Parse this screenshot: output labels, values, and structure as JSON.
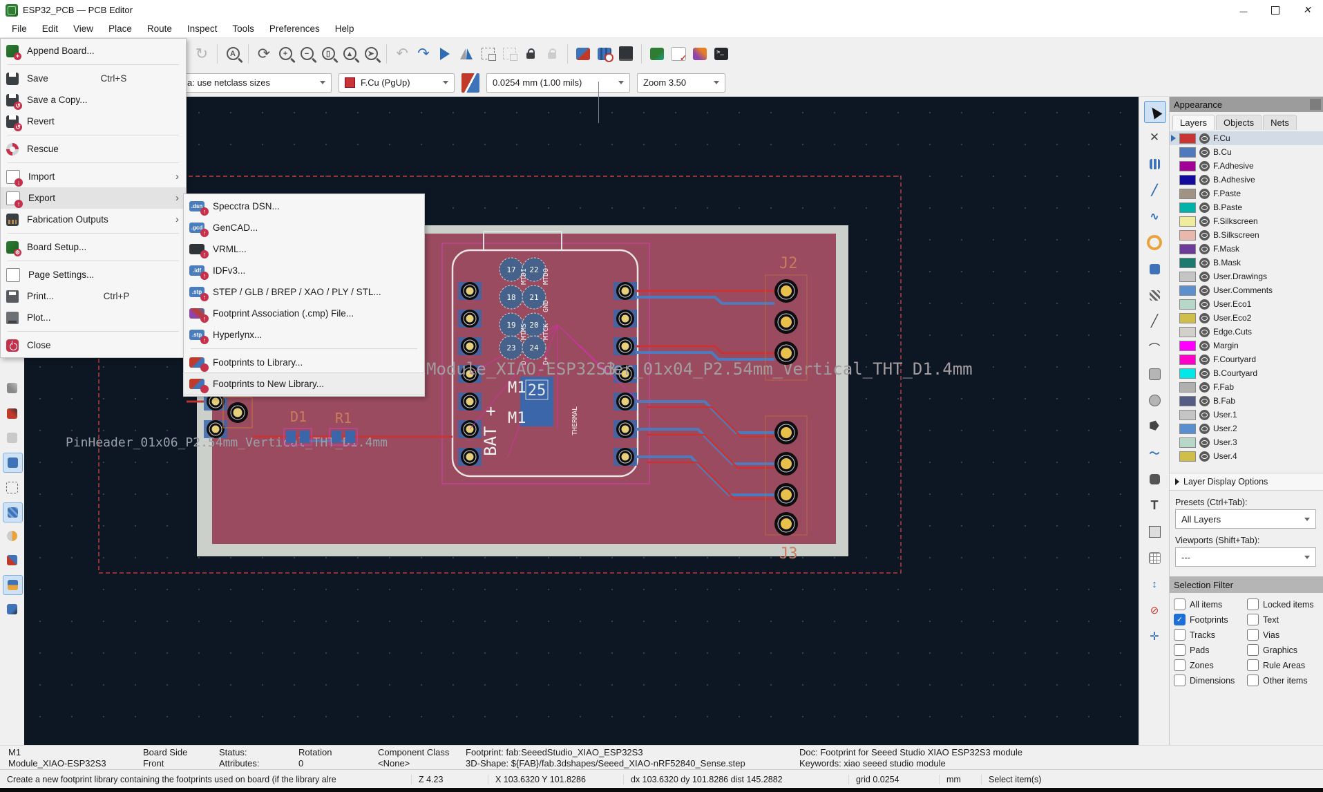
{
  "window": {
    "title": "ESP32_PCB — PCB Editor"
  },
  "menubar": {
    "items": [
      {
        "label": "File"
      },
      {
        "label": "Edit"
      },
      {
        "label": "View"
      },
      {
        "label": "Place"
      },
      {
        "label": "Route"
      },
      {
        "label": "Inspect"
      },
      {
        "label": "Tools"
      },
      {
        "label": "Preferences"
      },
      {
        "label": "Help"
      }
    ]
  },
  "file_menu": {
    "items": [
      {
        "label": "Append Board...",
        "icon": "append"
      },
      {
        "sep": true
      },
      {
        "label": "Save",
        "shortcut": "Ctrl+S",
        "icon": "save"
      },
      {
        "label": "Save a Copy...",
        "icon": "save-copy"
      },
      {
        "label": "Revert",
        "icon": "revert"
      },
      {
        "sep": true
      },
      {
        "label": "Rescue",
        "icon": "rescue"
      },
      {
        "sep": true
      },
      {
        "label": "Import",
        "arrow": "›",
        "icon": "import"
      },
      {
        "label": "Export",
        "arrow": "›",
        "icon": "export",
        "highlighted": true
      },
      {
        "label": "Fabrication Outputs",
        "arrow": "›",
        "icon": "fab"
      },
      {
        "sep": true
      },
      {
        "label": "Board Setup...",
        "icon": "board-setup"
      },
      {
        "sep": true
      },
      {
        "label": "Page Settings...",
        "icon": "page"
      },
      {
        "label": "Print...",
        "shortcut": "Ctrl+P",
        "icon": "print"
      },
      {
        "label": "Plot...",
        "icon": "plot"
      },
      {
        "sep": true
      },
      {
        "label": "Close",
        "icon": "close"
      }
    ]
  },
  "export_submenu": {
    "items": [
      {
        "label": "Specctra DSN...",
        "badge": ".dsn",
        "icon": "dsn"
      },
      {
        "label": "GenCAD...",
        "badge": ".gcd",
        "icon": "gcd"
      },
      {
        "label": "VRML...",
        "badge": "",
        "icon": "vrml"
      },
      {
        "label": "IDFv3...",
        "badge": ".idf",
        "icon": "idf"
      },
      {
        "label": "STEP / GLB / BREP / XAO / PLY / STL...",
        "badge": ".stp",
        "icon": "stp"
      },
      {
        "label": "Footprint Association (.cmp) File...",
        "badge": "",
        "icon": "cmp"
      },
      {
        "label": "Hyperlynx...",
        "badge": ".stp",
        "icon": "hyp"
      },
      {
        "sep": true
      },
      {
        "label": "Footprints to Library...",
        "badge": "",
        "icon": "libadd"
      },
      {
        "label": "Footprints to New Library...",
        "badge": "",
        "icon": "libnew",
        "hovered": true
      }
    ]
  },
  "toolbar2": {
    "netclass_combo": "a: use netclass sizes",
    "layer_combo": "F.Cu (PgUp)",
    "track_width_combo": "0.0254 mm (1.00 mils)",
    "zoom_combo": "Zoom 3.50"
  },
  "appearance": {
    "title": "Appearance",
    "tabs": [
      {
        "label": "Layers",
        "active": true
      },
      {
        "label": "Objects"
      },
      {
        "label": "Nets"
      }
    ],
    "layers": [
      {
        "name": "F.Cu",
        "color": "#c83434",
        "selected": true
      },
      {
        "name": "B.Cu",
        "color": "#4f7bbd"
      },
      {
        "name": "F.Adhesive",
        "color": "#a30097"
      },
      {
        "name": "B.Adhesive",
        "color": "#120a9c"
      },
      {
        "name": "F.Paste",
        "color": "#a09383"
      },
      {
        "name": "B.Paste",
        "color": "#00b3a8"
      },
      {
        "name": "F.Silkscreen",
        "color": "#f0ec9e"
      },
      {
        "name": "B.Silkscreen",
        "color": "#e9b8ac"
      },
      {
        "name": "F.Mask",
        "color": "#6d3c9a"
      },
      {
        "name": "B.Mask",
        "color": "#1d7a6f"
      },
      {
        "name": "User.Drawings",
        "color": "#c5c5c5"
      },
      {
        "name": "User.Comments",
        "color": "#5c8fcc"
      },
      {
        "name": "User.Eco1",
        "color": "#b7d7c9"
      },
      {
        "name": "User.Eco2",
        "color": "#cfbf4a"
      },
      {
        "name": "Edge.Cuts",
        "color": "#d3d0cb"
      },
      {
        "name": "Margin",
        "color": "#ff00ff"
      },
      {
        "name": "F.Courtyard",
        "color": "#ff00c8"
      },
      {
        "name": "B.Courtyard",
        "color": "#00e8e8"
      },
      {
        "name": "F.Fab",
        "color": "#b0b0b0"
      },
      {
        "name": "B.Fab",
        "color": "#545d84"
      },
      {
        "name": "User.1",
        "color": "#c5c5c5"
      },
      {
        "name": "User.2",
        "color": "#598fcc"
      },
      {
        "name": "User.3",
        "color": "#b7d7c9"
      },
      {
        "name": "User.4",
        "color": "#cfbf4a"
      }
    ],
    "layer_display_options": "Layer Display Options",
    "presets_label": "Presets (Ctrl+Tab):",
    "presets_value": "All Layers",
    "viewports_label": "Viewports (Shift+Tab):",
    "viewports_value": "---"
  },
  "selection_filter": {
    "title": "Selection Filter",
    "items": [
      {
        "label": "All items"
      },
      {
        "label": "Locked items"
      },
      {
        "label": "Footprints",
        "checked": true
      },
      {
        "label": "Text"
      },
      {
        "label": "Tracks"
      },
      {
        "label": "Vias"
      },
      {
        "label": "Pads"
      },
      {
        "label": "Graphics"
      },
      {
        "label": "Zones"
      },
      {
        "label": "Rule Areas"
      },
      {
        "label": "Dimensions"
      },
      {
        "label": "Other items"
      }
    ]
  },
  "status_bar": {
    "ref": "M1",
    "value": "Module_XIAO-ESP32S3",
    "board_side_label": "Board Side",
    "board_side": "Front",
    "status_label": "Status:",
    "attributes_label": "Attributes:",
    "rotation_label": "Rotation",
    "rotation": "0",
    "component_class_label": "Component Class",
    "component_class": "<None>",
    "footprint": "Footprint: fab:SeeedStudio_XIAO_ESP32S3",
    "shape3d": "3D-Shape: ${FAB}/fab.3dshapes/Seeed_XIAO-nRF52840_Sense.step",
    "doc": "Doc: Footprint for Seeed Studio XIAO ESP32S3 module",
    "keywords": "Keywords: xiao seeed studio module"
  },
  "footer": {
    "hint": "Create a new footprint library containing the footprints used on board (if the library alre",
    "z": "Z 4.23",
    "xy": "X 103.6320  Y 101.8286",
    "dxy": "dx 103.6320  dy 101.8286  dist 145.2882",
    "grid": "grid 0.0254",
    "units": "mm",
    "mode": "Select item(s)"
  },
  "canvas": {
    "labels": {
      "module_ref": "Module_XIAO-ESP32S3",
      "header4_ref": "der_01x04_P2.54mm_Vertical_THT_D1.4mm",
      "header6_ref": "PinHeader_01x06_P2.54mm_Vertical_THT_D1.4mm",
      "j2": "J2",
      "j3": "J3",
      "d1": "D1",
      "r1": "R1",
      "m1a": "M1",
      "m1b": "M1",
      "bat": "BAT +",
      "pad25": "25",
      "thermal": "THERMAL"
    },
    "pins": [
      {
        "n": "17",
        "label": "MTDI"
      },
      {
        "n": "22",
        "label": "MTDO"
      },
      {
        "n": "18",
        "label": ""
      },
      {
        "n": "21",
        "label": "GND"
      },
      {
        "n": "19",
        "label": "MTMS"
      },
      {
        "n": "20",
        "label": "MTCK"
      },
      {
        "n": "23",
        "label": "D-"
      },
      {
        "n": "24",
        "label": "D+"
      }
    ]
  }
}
